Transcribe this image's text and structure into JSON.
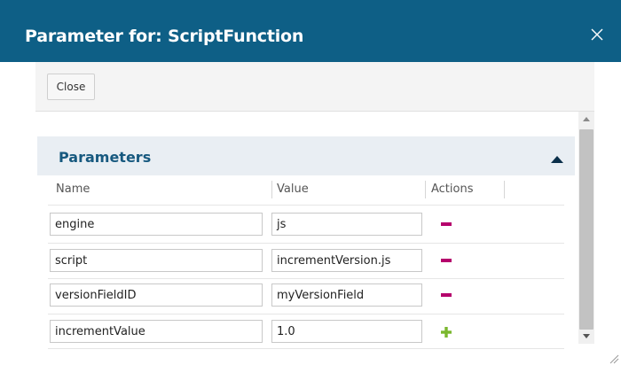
{
  "dialog": {
    "title": "Parameter for: ScriptFunction",
    "close_icon": "close-icon",
    "toolbar": {
      "close_label": "Close"
    }
  },
  "panel": {
    "title": "Parameters",
    "toggle_icon": "collapse-arrow-icon",
    "columns": {
      "name": "Name",
      "value": "Value",
      "actions": "Actions"
    },
    "rows": [
      {
        "name": "engine",
        "value": "js",
        "action": "remove"
      },
      {
        "name": "script",
        "value": "incrementVersion.js",
        "action": "remove"
      },
      {
        "name": "versionFieldID",
        "value": "myVersionField",
        "action": "remove"
      },
      {
        "name": "incrementValue",
        "value": "1.0",
        "action": "add"
      }
    ]
  },
  "colors": {
    "titlebar": "#0e5f86",
    "panel_header_bg": "#e9eef3",
    "panel_title": "#17597f",
    "remove_action": "#b5006c",
    "add_action": "#7ab72e"
  }
}
